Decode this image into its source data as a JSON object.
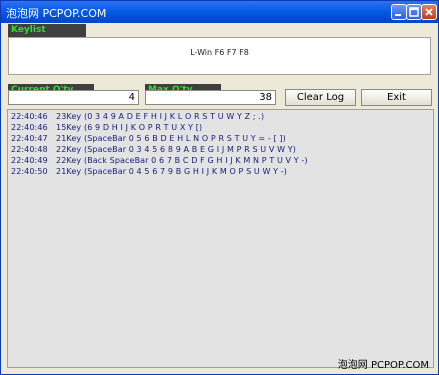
{
  "window": {
    "title": "泡泡网 PCPOP.COM",
    "title_buttons": [
      "minimize-icon",
      "maximize-icon",
      "close-icon"
    ]
  },
  "keylist": {
    "label": "Keylist",
    "value": "L-Win F6 F7 F8"
  },
  "counters": {
    "current_label": "Current Q'ty",
    "current_value": "4",
    "max_label": "Max Q'ty",
    "max_value": "38"
  },
  "buttons": {
    "clear_log": "Clear Log",
    "exit": "Exit"
  },
  "log": [
    {
      "time": "22:40:46",
      "keys": "23Key",
      "detail": "(0 3 4 9 A D E F H I J K L O R S T U W Y Z ; .)"
    },
    {
      "time": "22:40:46",
      "keys": "15Key",
      "detail": "(6 9 D H I J K O P R T U X Y [)"
    },
    {
      "time": "22:40:47",
      "keys": "21Key",
      "detail": "(SpaceBar 0 5 6 B D E H L N O P R S T U Y = - [ ])"
    },
    {
      "time": "22:40:48",
      "keys": "22Key",
      "detail": "(SpaceBar 0 3 4 5 6 8 9 A B E G I J M P R S U V W Y)"
    },
    {
      "time": "22:40:49",
      "keys": "22Key",
      "detail": "(Back SpaceBar 0 6 7 B C D F G H I J K M N P T U V Y -)"
    },
    {
      "time": "22:40:50",
      "keys": "21Key",
      "detail": "(SpaceBar 0 4 5 6 7 9 B G H I J K M O P S U W Y -)"
    }
  ],
  "watermark": "泡泡网 PCPOP.COM",
  "colors": {
    "titlebar": "#0a5ee8",
    "tag_bg": "#3f3f3f",
    "tag_text": "#2fe02f",
    "log_text": "#1c1c7a",
    "log_bg": "#e3e3e3"
  }
}
